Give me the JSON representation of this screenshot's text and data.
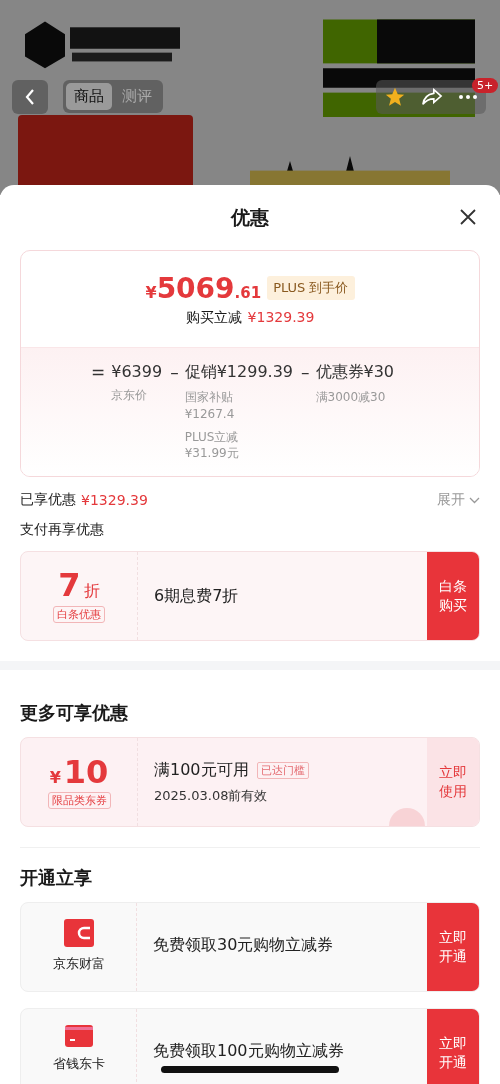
{
  "header": {
    "tabs": [
      {
        "label": "商品",
        "selected": true
      },
      {
        "label": "测评",
        "selected": false
      }
    ],
    "badge": "5+"
  },
  "sheet": {
    "title": "优惠"
  },
  "price_card": {
    "currency": "¥",
    "price_int": "5069",
    "price_dec": ".61",
    "tag": "PLUS 到手价",
    "reduce_label": "购买立减",
    "reduce_amount": "¥1329.39",
    "breakdown": [
      {
        "operator": "=",
        "label": "¥6399",
        "details": [
          {
            "name": "京东价"
          }
        ]
      },
      {
        "operator": "–",
        "label": "促销¥1299.39",
        "details": [
          {
            "name": "国家补贴",
            "amount": "¥1267.4"
          },
          {
            "name": "PLUS立减",
            "amount": "¥31.99元"
          }
        ]
      },
      {
        "operator": "–",
        "label": "优惠券¥30",
        "details": [
          {
            "name": "满3000减30"
          }
        ]
      }
    ]
  },
  "enjoyed": {
    "label": "已享优惠",
    "amount": "¥1329.39",
    "toggle": "展开",
    "expanded": false
  },
  "pay_section": {
    "title": "支付再享优惠",
    "offers": [
      {
        "value": "7",
        "unit": "折",
        "tag": "白条优惠",
        "text": "6期息费7折",
        "action": "白条购买"
      }
    ]
  },
  "more_section": {
    "title": "更多可享优惠",
    "coupons": [
      {
        "currency": "¥",
        "value": "10",
        "tag": "限品类东券",
        "condition": "满100元可用",
        "badge": "已达门槛",
        "validity": "2025.03.08前有效",
        "claimed": true,
        "action": "立即使用"
      }
    ]
  },
  "open_section": {
    "title": "开通立享",
    "items": [
      {
        "kind": "wallet",
        "name": "京东财富",
        "text": "免费领取30元购物立减券",
        "action": "立即开通"
      },
      {
        "kind": "card",
        "name": "省钱东卡",
        "text": "免费领取100元购物立减券",
        "action": "立即开通"
      }
    ]
  }
}
